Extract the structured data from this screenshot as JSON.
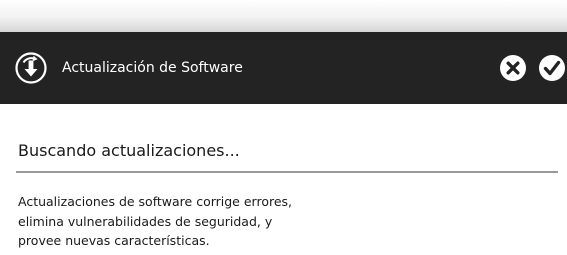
{
  "dialog": {
    "title": "Actualización de Software",
    "app_icon": "update-download-icon",
    "close_icon": "close-icon",
    "confirm_icon": "checkmark-icon"
  },
  "content": {
    "status": "Buscando actualizaciones...",
    "description": "Actualizaciones de software corrige errores, elimina vulnerabilidades de seguridad, y provee nuevas características."
  },
  "colors": {
    "title_bar": "#232323",
    "title_text": "#ffffff",
    "body_background": "#ffffff",
    "divider": "#9a9a9a"
  }
}
